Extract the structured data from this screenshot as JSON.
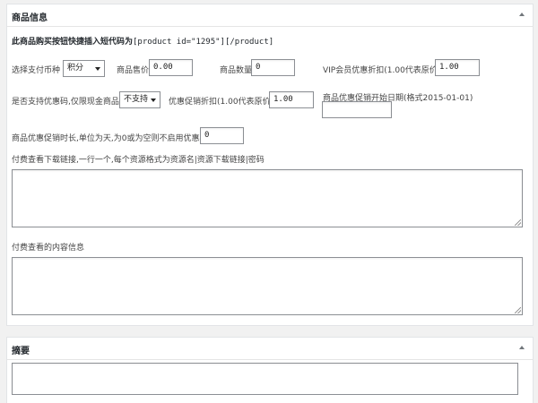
{
  "product_box": {
    "title": "商品信息",
    "shortcode_text": "此商品购买按钮快捷插入短代码为",
    "shortcode_code": "[product id=\"1295\"][/product]",
    "payment_currency": {
      "label": "选择支付币种",
      "selected": "积分"
    },
    "price": {
      "label": "商品售价",
      "value": "0.00"
    },
    "quantity": {
      "label": "商品数量",
      "value": "0"
    },
    "vip_discount": {
      "label": "VIP会员优惠折扣(1.00代表原价)",
      "value": "1.00"
    },
    "coupon": {
      "label": "是否支持优惠码,仅限现金商品",
      "selected": "不支持"
    },
    "promo_discount": {
      "label": "优惠促销折扣(1.00代表原价)",
      "value": "1.00"
    },
    "promo_start": {
      "label": "商品优惠促销开始日期(格式2015-01-01)",
      "value": ""
    },
    "promo_duration": {
      "label": "商品优惠促销时长,单位为天,为0或为空则不启用优惠期",
      "value": "0"
    },
    "download_links": {
      "label": "付费查看下载链接,一行一个,每个资源格式为资源名|资源下载链接|密码",
      "value": ""
    },
    "paid_content": {
      "label": "付费查看的内容信息",
      "value": ""
    }
  },
  "excerpt_box": {
    "title": "摘要"
  },
  "icons": {
    "toggle": "triangle-up-icon",
    "dropdown": "chevron-down-icon",
    "resize": "resize-grip-icon"
  },
  "colors": {
    "background": "#f1f1f1",
    "panel": "#ffffff",
    "border": "#e2e4e7",
    "input_border": "#8c8f94"
  }
}
